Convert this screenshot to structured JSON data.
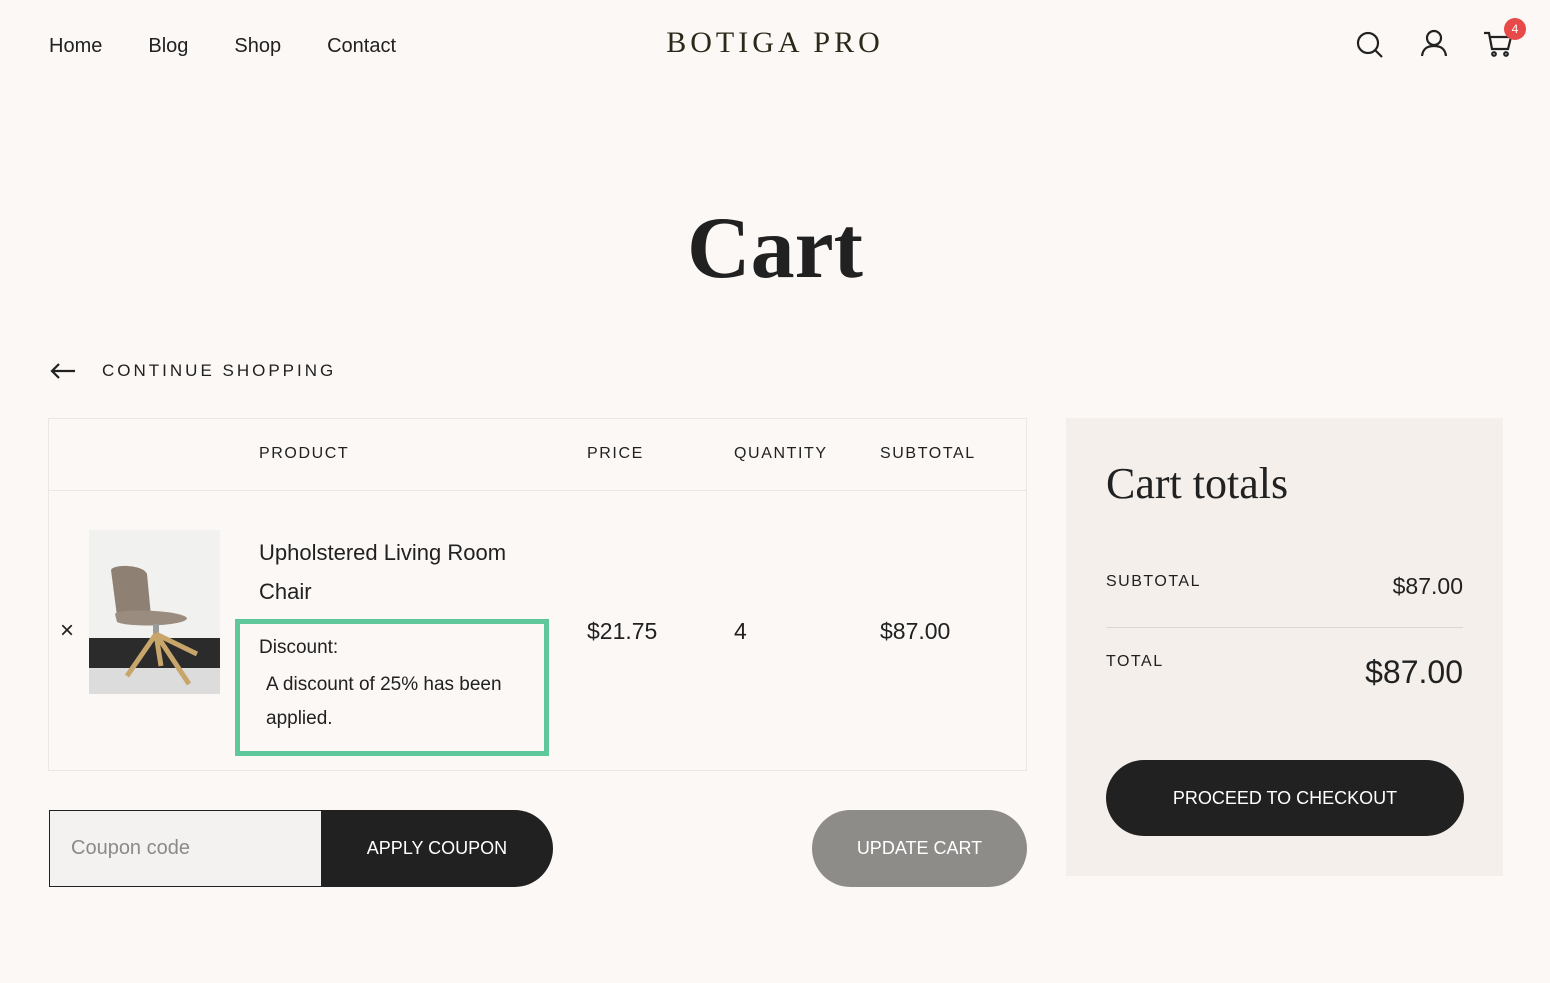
{
  "nav": {
    "items": [
      "Home",
      "Blog",
      "Shop",
      "Contact"
    ]
  },
  "logo": "BOTIGA PRO",
  "header": {
    "icons": [
      "search-icon",
      "user-icon",
      "cart-icon"
    ],
    "cart_count": "4",
    "badge_color": "#e84a4a"
  },
  "page_title": "Cart",
  "continue_shopping": "CONTINUE SHOPPING",
  "table": {
    "columns": {
      "product": "PRODUCT",
      "price": "PRICE",
      "quantity": "QUANTITY",
      "subtotal": "SUBTOTAL"
    },
    "rows": [
      {
        "remove": "×",
        "product": "Upholstered Living Room Chair",
        "discount_label": "Discount:",
        "discount_text": "A discount of 25% has been applied.",
        "price": "$21.75",
        "quantity": "4",
        "subtotal": "$87.00"
      }
    ]
  },
  "coupon": {
    "placeholder": "Coupon code",
    "apply_label": "APPLY COUPON"
  },
  "update_label": "UPDATE CART",
  "totals": {
    "title": "Cart totals",
    "subtotal_label": "SUBTOTAL",
    "subtotal_value": "$87.00",
    "total_label": "TOTAL",
    "total_value": "$87.00",
    "checkout_label": "PROCEED TO CHECKOUT"
  },
  "colors": {
    "highlight": "#5ec89b",
    "dark": "#212121",
    "background": "#fcf8f5",
    "totals_bg": "#f4efea"
  }
}
